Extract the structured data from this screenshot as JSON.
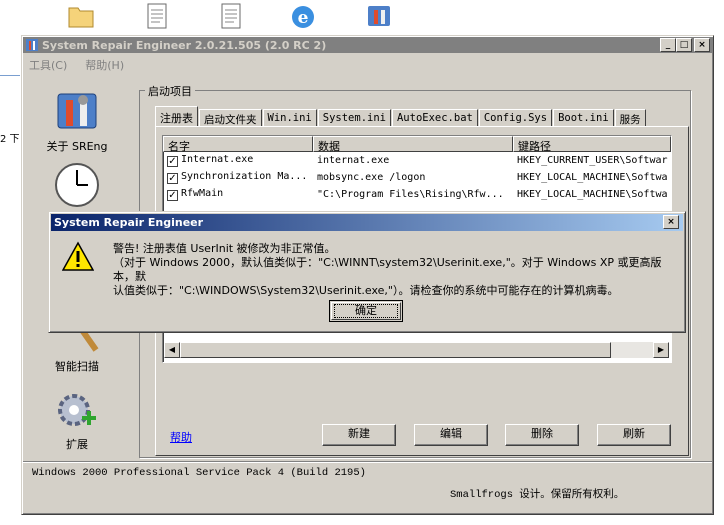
{
  "desktop_icons": [
    "folder-icon",
    "document-icon",
    "document-icon",
    "ie-icon",
    "srepair-icon"
  ],
  "edge_text": "2 下",
  "window": {
    "title": "System Repair Engineer 2.0.21.505 (2.0 RC 2)",
    "buttons": [
      "_",
      "□",
      "×"
    ]
  },
  "menu": [
    "工具(C)",
    "帮助(H)"
  ],
  "sidebar": [
    {
      "label": "关于 SREng",
      "icon": "toolbox-icon"
    },
    {
      "label": "",
      "icon": "clock-icon"
    },
    {
      "label": "智能扫描",
      "icon": "magnifier-icon"
    },
    {
      "label": "扩展",
      "icon": "gear-plus-icon"
    }
  ],
  "group_label": "启动项目",
  "tabs": [
    "注册表",
    "启动文件夹",
    "Win.ini",
    "System.ini",
    "AutoExec.bat",
    "Config.Sys",
    "Boot.ini",
    "服务"
  ],
  "table": {
    "columns": [
      "名字",
      "数据",
      "键路径"
    ],
    "rows": [
      {
        "checked": true,
        "name": "Internat.exe",
        "data": "internat.exe",
        "path": "HKEY_CURRENT_USER\\Softwar"
      },
      {
        "checked": true,
        "name": "Synchronization Ma...",
        "data": "mobsync.exe /logon",
        "path": "HKEY_LOCAL_MACHINE\\Softwa"
      },
      {
        "checked": true,
        "name": "RfwMain",
        "data": "\"C:\\Program Files\\Rising\\Rfw...",
        "path": "HKEY_LOCAL_MACHINE\\Softwa"
      }
    ]
  },
  "help_link": "帮助",
  "action_buttons": [
    "新建",
    "编辑",
    "删除",
    "刷新"
  ],
  "status": {
    "os": "Windows 2000 Professional Service Pack 4 (Build 2195)",
    "copyright": "Smallfrogs 设计。保留所有权利。"
  },
  "dialog": {
    "title": "System Repair Engineer",
    "line1": "警告! 注册表值 UserInit 被修改为非正常值。",
    "line2": "（对于 Windows 2000，默认值类似于：\"C:\\WINNT\\system32\\Userinit.exe,\"。对于 Windows XP 或更高版本，默",
    "line3": "认值类似于：\"C:\\WINDOWS\\System32\\Userinit.exe,\"）。请检查你的系统中可能存在的计算机病毒。",
    "ok": "确定"
  }
}
